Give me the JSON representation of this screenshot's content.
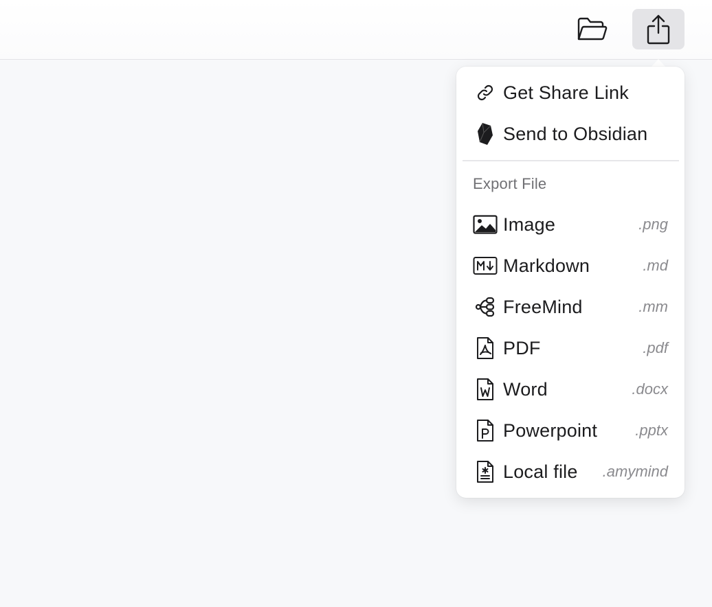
{
  "toolbar": {
    "folder_icon": "folder-open-icon",
    "share_icon": "share-icon"
  },
  "menu": {
    "share_items": [
      {
        "label": "Get Share Link",
        "icon": "link-icon"
      },
      {
        "label": "Send to Obsidian",
        "icon": "obsidian-icon"
      }
    ],
    "export_section_label": "Export File",
    "export_items": [
      {
        "label": "Image",
        "ext": ".png",
        "icon": "image-icon"
      },
      {
        "label": "Markdown",
        "ext": ".md",
        "icon": "markdown-icon"
      },
      {
        "label": "FreeMind",
        "ext": ".mm",
        "icon": "mindmap-icon"
      },
      {
        "label": "PDF",
        "ext": ".pdf",
        "icon": "pdf-file-icon"
      },
      {
        "label": "Word",
        "ext": ".docx",
        "icon": "word-file-icon"
      },
      {
        "label": "Powerpoint",
        "ext": ".pptx",
        "icon": "powerpoint-file-icon"
      },
      {
        "label": "Local file",
        "ext": ".amymind",
        "icon": "local-file-icon"
      }
    ]
  },
  "colors": {
    "background": "#f7f8fa",
    "menu_background": "#ffffff",
    "active_button": "#e4e4e7",
    "text": "#1c1c1e",
    "secondary_text": "#8a8a8e"
  }
}
